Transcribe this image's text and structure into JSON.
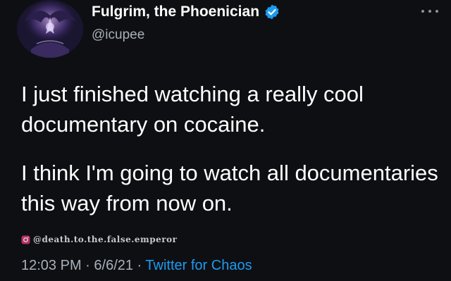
{
  "author": {
    "display_name": "Fulgrim, the Phoenician",
    "handle": "@icupee",
    "verified_icon": "verified-badge-icon",
    "verified_color": "#1d9bf0"
  },
  "tweet": {
    "paragraphs": [
      "I just finished watching a really cool documentary on cocaine.",
      "I think I'm going to watch all documentaries this way from now on."
    ]
  },
  "watermark": {
    "icon": "instagram-icon",
    "text": "@death.to.the.false.emperor"
  },
  "meta": {
    "time": "12:03 PM",
    "separator": " · ",
    "date": "6/6/21",
    "source": "Twitter for Chaos",
    "source_color": "#1d9bf0"
  },
  "colors": {
    "background": "#0e0f13",
    "text_primary": "#ffffff",
    "text_secondary": "#a9b0b8"
  }
}
